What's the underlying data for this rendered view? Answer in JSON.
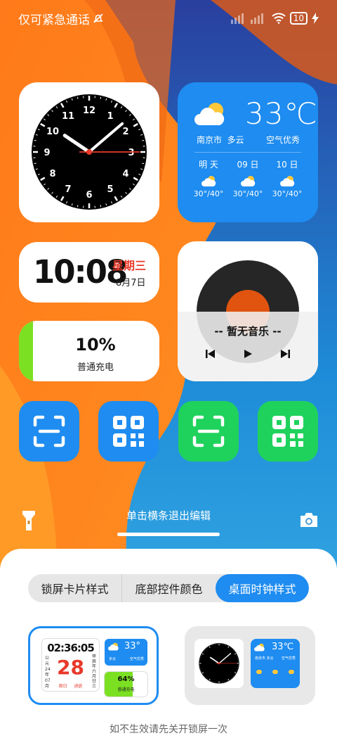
{
  "status": {
    "left_text": "仅可紧急通话",
    "battery": "10"
  },
  "weather": {
    "temp": "33℃",
    "city": "南京市",
    "condition": "多云",
    "air_quality": "空气优秀",
    "forecast": [
      {
        "day": "明 天",
        "range": "30°/40°"
      },
      {
        "day": "09 日",
        "range": "30°/40°"
      },
      {
        "day": "10 日",
        "range": "30°/40°"
      }
    ]
  },
  "clock": {
    "numbers": [
      "12",
      "1",
      "2",
      "3",
      "4",
      "5",
      "6",
      "7",
      "8",
      "9",
      "10",
      "11"
    ],
    "hour_value": 10,
    "minute_value": 8,
    "second_value": 15
  },
  "datecard": {
    "time": "10:08",
    "weekday": "星期三",
    "date": "8月7日"
  },
  "charging": {
    "percent": "10%",
    "label": "普通充电",
    "level": 0.1
  },
  "music": {
    "title": "-- 暂无音乐 --"
  },
  "hint": "单击横条退出编辑",
  "tabs": [
    {
      "label": "锁屏卡片样式",
      "active": false
    },
    {
      "label": "底部控件颜色",
      "active": false
    },
    {
      "label": "桌面时钟样式",
      "active": true
    }
  ],
  "option1": {
    "time": "02:36:05",
    "big_date": "28",
    "left_col": "公\n元\n24\n年\n07\n月",
    "right_col": "甲\n辰\n年\n六\n月\n廿\n三",
    "week_label": "周日",
    "extra_label": "迪延",
    "weather_temp": "33°",
    "weather_city": "多云",
    "weather_aq": "空气优秀",
    "charge_pct": "64%",
    "charge_label": "普通充电"
  },
  "option2": {
    "temp": "33℃",
    "city": "南京市 多云",
    "aq": "空气优秀"
  },
  "footer": "如不生效请先关开锁屏一次",
  "colors": {
    "accent": "#1e8cf0",
    "green": "#1fd25c",
    "charge": "#7be022",
    "red": "#e8392a"
  }
}
